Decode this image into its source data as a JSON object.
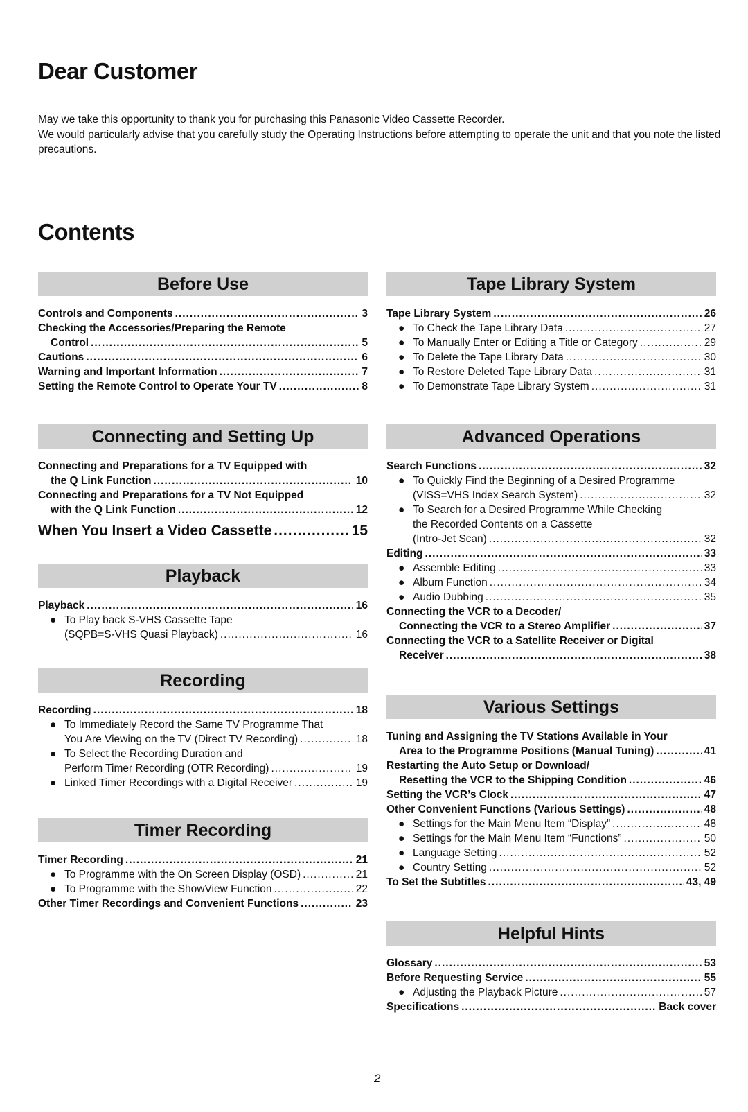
{
  "greeting": {
    "title": "Dear Customer",
    "paragraphs": [
      "May we take this opportunity to thank you for purchasing this Panasonic Video Cassette Recorder.",
      "We would particularly advise that you carefully study the Operating Instructions before attempting to operate the unit and that you note the listed precautions."
    ]
  },
  "contents_title": "Contents",
  "bullet_glyph": "●",
  "left": {
    "before_use": {
      "heading": "Before Use",
      "e0": {
        "text": "Controls and Components",
        "page": "3"
      },
      "e1": {
        "line1": "Checking the Accessories/Preparing the Remote",
        "text": "Control",
        "page": "5"
      },
      "e2": {
        "text": "Cautions",
        "page": "6"
      },
      "e3": {
        "text": "Warning and Important Information",
        "page": "7"
      },
      "e4": {
        "text": "Setting the Remote Control to Operate Your TV",
        "page": "8"
      }
    },
    "connecting": {
      "heading": "Connecting and Setting Up",
      "e0": {
        "line1": "Connecting and Preparations for a TV Equipped with",
        "text": "the Q Link Function",
        "page": "10"
      },
      "e1": {
        "line1": "Connecting and Preparations for a TV Not Equipped",
        "text": "with the Q Link Function",
        "page": "12"
      },
      "e2": {
        "text": "When You Insert a Video Cassette",
        "page": "15"
      }
    },
    "playback": {
      "heading": "Playback",
      "e0": {
        "text": "Playback",
        "page": "16"
      },
      "e1": {
        "line1": "To Play back S-VHS Cassette Tape",
        "text": "(SQPB=S-VHS Quasi Playback)",
        "page": "16"
      }
    },
    "recording": {
      "heading": "Recording",
      "e0": {
        "text": "Recording",
        "page": "18"
      },
      "e1": {
        "line1": "To Immediately Record the Same TV Programme That",
        "text": "You Are Viewing on the TV (Direct TV Recording)",
        "page": "18"
      },
      "e2": {
        "line1": "To Select the Recording Duration and",
        "text": "Perform Timer Recording (OTR Recording)",
        "page": "19"
      },
      "e3": {
        "text": "Linked Timer Recordings with a Digital Receiver",
        "page": "19"
      }
    },
    "timer": {
      "heading": "Timer Recording",
      "e0": {
        "text": "Timer Recording",
        "page": "21"
      },
      "e1": {
        "text": "To Programme with the On Screen Display (OSD)",
        "page": "21"
      },
      "e2": {
        "text": "To Programme with the ShowView Function",
        "page": "22"
      },
      "e3": {
        "text": "Other Timer Recordings and Convenient Functions",
        "page": "23"
      }
    }
  },
  "right": {
    "tape_library": {
      "heading": "Tape Library System",
      "e0": {
        "text": "Tape Library System",
        "page": "26"
      },
      "e1": {
        "text": "To Check the Tape Library Data",
        "page": "27"
      },
      "e2": {
        "text": "To Manually Enter or Editing a Title or Category",
        "page": "29"
      },
      "e3": {
        "text": "To Delete the Tape Library Data",
        "page": "30"
      },
      "e4": {
        "text": "To Restore Deleted Tape Library Data",
        "page": "31"
      },
      "e5": {
        "text": "To Demonstrate Tape Library System",
        "page": "31"
      }
    },
    "advanced": {
      "heading": "Advanced Operations",
      "e0": {
        "text": "Search Functions",
        "page": "32"
      },
      "e1": {
        "line1": "To Quickly Find the Beginning of a Desired Programme",
        "text": "(VISS=VHS Index Search System)",
        "page": "32"
      },
      "e2": {
        "line1": "To Search for a Desired Programme While Checking",
        "line2": "the Recorded Contents on a Cassette",
        "text": "(Intro-Jet Scan)",
        "page": "32"
      },
      "e3": {
        "text": "Editing",
        "page": "33"
      },
      "e4": {
        "text": "Assemble Editing",
        "page": "33"
      },
      "e5": {
        "text": "Album Function",
        "page": "34"
      },
      "e6": {
        "text": "Audio Dubbing",
        "page": "35"
      },
      "e7": {
        "line1": "Connecting the VCR to a Decoder/",
        "text": "Connecting the VCR to a Stereo Amplifier",
        "page": "37"
      },
      "e8": {
        "line1": "Connecting the VCR to a Satellite Receiver or Digital",
        "text": "Receiver",
        "page": "38"
      }
    },
    "various": {
      "heading": "Various Settings",
      "e0": {
        "line1": "Tuning and Assigning the TV Stations Available in Your",
        "text": "Area to the Programme Positions (Manual Tuning)",
        "page": "41"
      },
      "e1": {
        "line1": "Restarting the Auto Setup or Download/",
        "text": "Resetting the VCR to the Shipping Condition",
        "page": "46"
      },
      "e2": {
        "text": "Setting the VCR’s Clock",
        "page": "47"
      },
      "e3": {
        "text": "Other Convenient Functions (Various Settings)",
        "page": "48"
      },
      "e4": {
        "text": "Settings for the Main Menu Item “Display”",
        "page": "48"
      },
      "e5": {
        "text": "Settings for the Main Menu Item “Functions”",
        "page": "50"
      },
      "e6": {
        "text": "Language Setting",
        "page": "52"
      },
      "e7": {
        "text": "Country Setting",
        "page": "52"
      },
      "e8": {
        "text": "To Set the Subtitles",
        "page": "43, 49"
      }
    },
    "hints": {
      "heading": "Helpful Hints",
      "e0": {
        "text": "Glossary",
        "page": "53"
      },
      "e1": {
        "text": "Before Requesting Service",
        "page": "55"
      },
      "e2": {
        "text": "Adjusting the Playback Picture",
        "page": "57"
      },
      "e3": {
        "text": "Specifications",
        "page": "Back cover"
      }
    }
  },
  "page_number": "2"
}
